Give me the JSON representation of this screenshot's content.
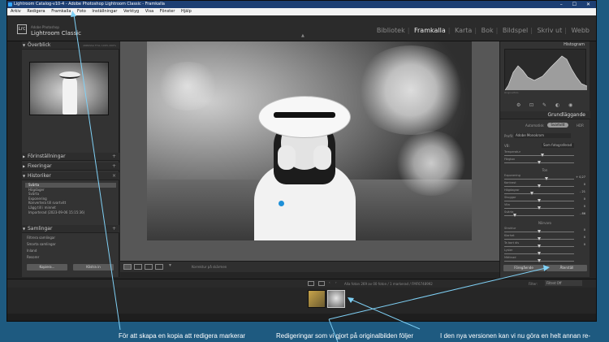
{
  "window": {
    "title": "Lightroom Catalog-v10-4 - Adobe Photoshop Lightroom Classic - Framkalla",
    "controls": "–  ☐  ✕"
  },
  "menu": [
    "Arkiv",
    "Redigera",
    "Framkalla",
    "Foto",
    "Inställningar",
    "Verktyg",
    "Visa",
    "Fönster",
    "Hjälp"
  ],
  "brand": {
    "small": "Adobe Photoshop",
    "name": "Lightroom Classic",
    "logo": "Lrc"
  },
  "modules": [
    "Bibliotek",
    "Framkalla",
    "Karta",
    "Bok",
    "Bildspel",
    "Skriv ut",
    "Webb"
  ],
  "active_module": "Framkalla",
  "left_panel": {
    "navigator": {
      "title": "Överblick",
      "options": "ANPASSA  FYLL  100%  200%"
    },
    "sections": [
      "Förinställningar",
      "Fixeringar",
      "Historiker"
    ],
    "history_items": [
      "Svärta",
      "Högdager",
      "Svärta",
      "Exponering",
      "Konvertera till svartvitt",
      "Lägg till i minnet",
      "Importerad (2023-09-06 15:15:36)"
    ],
    "collections_title": "Samlingar",
    "collections": [
      "Filtrera samlingar",
      "Smarta samlingar",
      "Inland",
      "Resorer"
    ],
    "copy_button": "Kopiera...",
    "paste_button": "Klistra in"
  },
  "toolbar": {
    "label": "Korrektur på skärmen"
  },
  "right_panel": {
    "histogram_title": "Histogram",
    "original_photo_label": "Originalfoto",
    "basic_title": "Grundläggande",
    "treatment": {
      "color": "Automatisk",
      "bw": "Svartvitt",
      "hdr": "HDR"
    },
    "profile_label": "Profil:",
    "profile_value": "Adobe Monokrom",
    "wb_label": "VB:",
    "wb_value": "Som fotograferad",
    "sliders_top": [
      {
        "label": "Temperatur",
        "value": "",
        "pos": 0.55
      },
      {
        "label": "Färgton",
        "value": "",
        "pos": 0.5
      }
    ],
    "tone_title": "Ton",
    "sliders_tone": [
      {
        "label": "Exponering",
        "value": "+ 0,27",
        "pos": 0.6
      },
      {
        "label": "Kontrast",
        "value": "0",
        "pos": 0.5
      },
      {
        "label": "Högdagrar",
        "value": "- 21",
        "pos": 0.4
      },
      {
        "label": "Skuggor",
        "value": "0",
        "pos": 0.5
      },
      {
        "label": "Vita",
        "value": "0",
        "pos": 0.5
      },
      {
        "label": "Svärta",
        "value": "- 86",
        "pos": 0.15
      }
    ],
    "presence_title": "Närvaro",
    "sliders_presence": [
      {
        "label": "Struktur",
        "value": "0",
        "pos": 0.5
      },
      {
        "label": "Klarhet",
        "value": "0",
        "pos": 0.5
      },
      {
        "label": "Ta bort dis",
        "value": "0",
        "pos": 0.5
      },
      {
        "label": "Lyster",
        "value": "",
        "pos": 0.5
      },
      {
        "label": "Mättnad",
        "value": "",
        "pos": 0.5
      }
    ],
    "prev_button": "Föregående",
    "reset_button": "Återställ"
  },
  "filmstrip": {
    "info": "Alla foton   269 av 00 foton / 1 markerad / FMF6748992",
    "filter_label": "Filter:",
    "filter_value": "Filtret Off"
  },
  "captions": [
    "För att skapa en kopia att redigera markerar",
    "Redigeringar som vi gjort på originalbilden följer",
    "I den nya versionen kan vi nu göra en helt annan re-"
  ],
  "colors": {
    "annotation": "#7fd0f5",
    "accent": "#31a8ff",
    "background": "#1e5a80"
  }
}
